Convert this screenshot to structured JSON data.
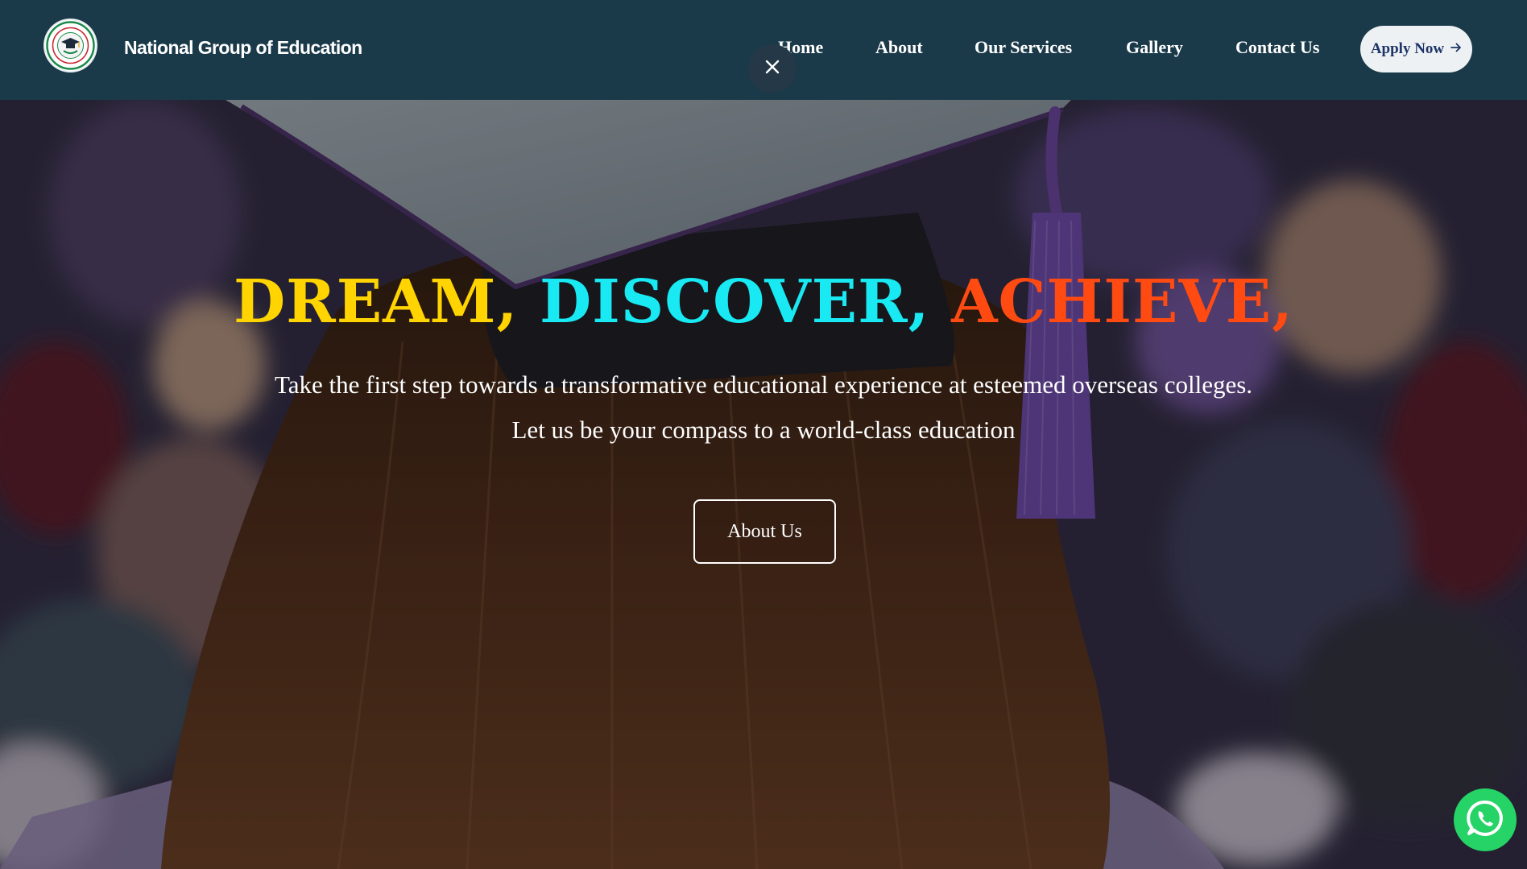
{
  "header": {
    "brand": "National Group of Education",
    "nav": {
      "home": "Home",
      "about": "About",
      "services": "Our Services",
      "gallery": "Gallery",
      "contact": "Contact Us"
    },
    "apply_label": "Apply Now",
    "icons": [
      "logo-emblem",
      "close-icon",
      "arrow-right-icon"
    ]
  },
  "hero": {
    "headline": {
      "word1": "DREAM,",
      "word2": "DISCOVER,",
      "word3": "ACHIEVE,"
    },
    "subtitle_line1": "Take the first step towards a transformative educational experience at esteemed overseas colleges.",
    "subtitle_line2": "Let us be your compass to a world-class education",
    "cta_label": "About Us",
    "background": "blurred graduation ceremony photo, student in cap with purple tassel viewed from behind"
  },
  "floating": {
    "icon": "whatsapp-icon"
  },
  "colors": {
    "header_bg": "#1a3a4a",
    "dream": "#ffd400",
    "discover": "#18e9f2",
    "achieve": "#ff4a12",
    "apply_bg": "#eef1f4",
    "apply_text": "#1d3566",
    "whatsapp": "#25d366"
  }
}
